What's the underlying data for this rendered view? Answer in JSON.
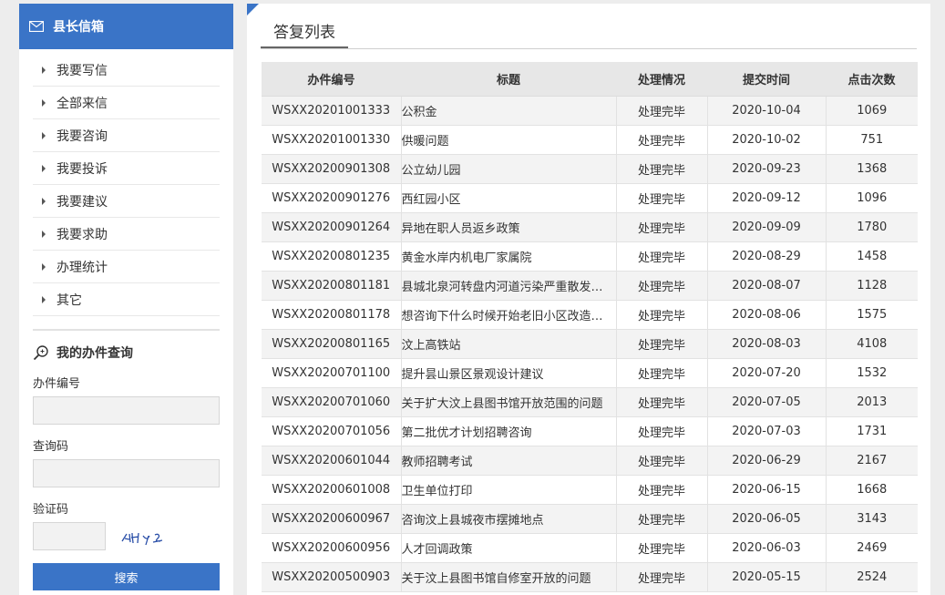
{
  "sidebar": {
    "header_title": "县长信箱",
    "header_icon": "mail-icon",
    "menu": [
      {
        "label": "我要写信"
      },
      {
        "label": "全部来信"
      },
      {
        "label": "我要咨询"
      },
      {
        "label": "我要投诉"
      },
      {
        "label": "我要建议"
      },
      {
        "label": "我要求助"
      },
      {
        "label": "办理统计"
      },
      {
        "label": "其它"
      }
    ],
    "query": {
      "title": "我的办件查询",
      "icon": "search-icon",
      "case_no_label": "办件编号",
      "case_no_value": "",
      "query_code_label": "查询码",
      "query_code_value": "",
      "captcha_label": "验证码",
      "captcha_value": "",
      "search_label": "搜索"
    }
  },
  "main": {
    "title": "答复列表",
    "columns": [
      "办件编号",
      "标题",
      "处理情况",
      "提交时间",
      "点击次数"
    ],
    "rows": [
      {
        "id": "WSXX20201001333",
        "title": "公积金",
        "status": "处理完毕",
        "date": "2020-10-04",
        "clicks": "1069"
      },
      {
        "id": "WSXX20201001330",
        "title": "供暖问题",
        "status": "处理完毕",
        "date": "2020-10-02",
        "clicks": "751"
      },
      {
        "id": "WSXX20200901308",
        "title": "公立幼儿园",
        "status": "处理完毕",
        "date": "2020-09-23",
        "clicks": "1368"
      },
      {
        "id": "WSXX20200901276",
        "title": "西红园小区",
        "status": "处理完毕",
        "date": "2020-09-12",
        "clicks": "1096"
      },
      {
        "id": "WSXX20200901264",
        "title": "异地在职人员返乡政策",
        "status": "处理完毕",
        "date": "2020-09-09",
        "clicks": "1780"
      },
      {
        "id": "WSXX20200801235",
        "title": "黄金水岸内机电厂家属院",
        "status": "处理完毕",
        "date": "2020-08-29",
        "clicks": "1458"
      },
      {
        "id": "WSXX20200801181",
        "title": "县城北泉河转盘内河道污染严重散发大...",
        "status": "处理完毕",
        "date": "2020-08-07",
        "clicks": "1128"
      },
      {
        "id": "WSXX20200801178",
        "title": "想咨询下什么时候开始老旧小区改造，...",
        "status": "处理完毕",
        "date": "2020-08-06",
        "clicks": "1575"
      },
      {
        "id": "WSXX20200801165",
        "title": "汶上高铁站",
        "status": "处理完毕",
        "date": "2020-08-03",
        "clicks": "4108"
      },
      {
        "id": "WSXX20200701100",
        "title": "提升昙山景区景观设计建议",
        "status": "处理完毕",
        "date": "2020-07-20",
        "clicks": "1532"
      },
      {
        "id": "WSXX20200701060",
        "title": "关于扩大汶上县图书馆开放范围的问题",
        "status": "处理完毕",
        "date": "2020-07-05",
        "clicks": "2013"
      },
      {
        "id": "WSXX20200701056",
        "title": "第二批优才计划招聘咨询",
        "status": "处理完毕",
        "date": "2020-07-03",
        "clicks": "1731"
      },
      {
        "id": "WSXX20200601044",
        "title": "教师招聘考试",
        "status": "处理完毕",
        "date": "2020-06-29",
        "clicks": "2167"
      },
      {
        "id": "WSXX20200601008",
        "title": "卫生单位打印",
        "status": "处理完毕",
        "date": "2020-06-15",
        "clicks": "1668"
      },
      {
        "id": "WSXX20200600967",
        "title": "咨询汶上县城夜市摆摊地点",
        "status": "处理完毕",
        "date": "2020-06-05",
        "clicks": "3143"
      },
      {
        "id": "WSXX20200600956",
        "title": "人才回调政策",
        "status": "处理完毕",
        "date": "2020-06-03",
        "clicks": "2469"
      },
      {
        "id": "WSXX20200500903",
        "title": "关于汶上县图书馆自修室开放的问题",
        "status": "处理完毕",
        "date": "2020-05-15",
        "clicks": "2524"
      }
    ]
  },
  "colors": {
    "accent": "#3a74c7",
    "background": "#ededed"
  }
}
